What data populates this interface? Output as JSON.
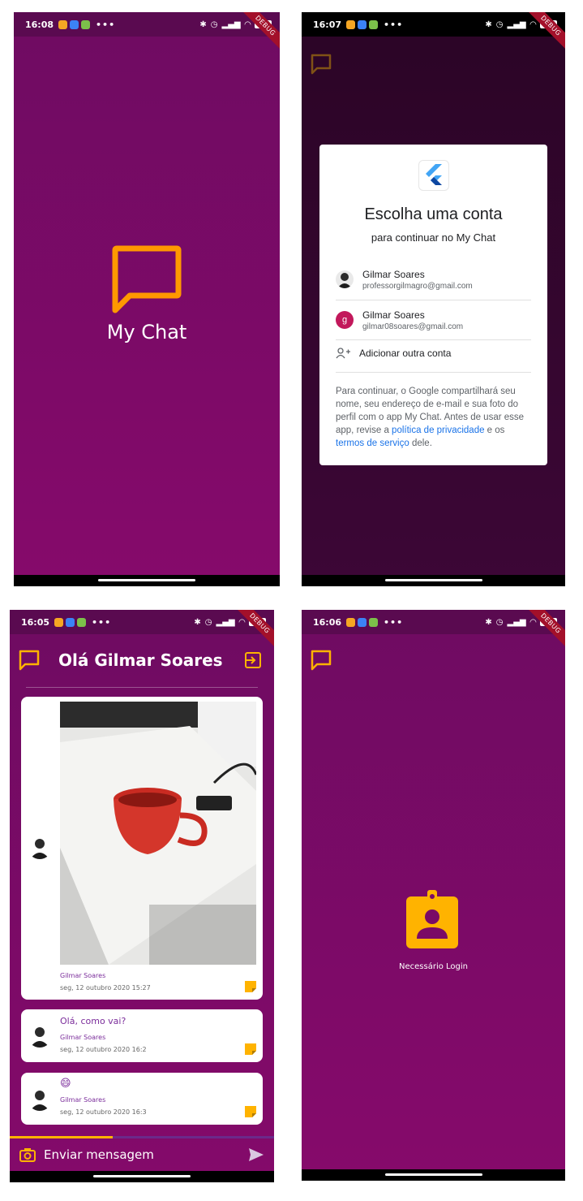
{
  "colors": {
    "primary": "#7a0a66",
    "accent": "#ffb300",
    "splash_logo": "#ff9800",
    "link": "#1a73e8"
  },
  "splash": {
    "status_time": "16:08",
    "battery": "100",
    "debug_label": "DEBUG",
    "app_title": "My Chat"
  },
  "account_picker": {
    "status_time": "16:07",
    "battery": "100",
    "debug_label": "DEBUG",
    "title": "Escolha uma conta",
    "subtitle": "para continuar no My Chat",
    "accounts": [
      {
        "name": "Gilmar Soares",
        "email": "professorgilmagro@gmail.com",
        "avatar": "photo"
      },
      {
        "name": "Gilmar Soares",
        "email": "gilmar08soares@gmail.com",
        "avatar": "g"
      }
    ],
    "add_account": "Adicionar outra conta",
    "note_part1": "Para continuar, o Google compartilhará seu nome, seu endereço de e-mail e sua foto do perfil com o app My Chat. Antes de usar esse app, revise a ",
    "privacy_link": "política de privacidade",
    "note_part2": " e os ",
    "terms_link": "termos de serviço",
    "note_part3": " dele."
  },
  "chat": {
    "status_time": "16:05",
    "battery": "100",
    "debug_label": "DEBUG",
    "header_title": "Olá Gilmar Soares",
    "messages": [
      {
        "type": "image",
        "sender": "Gilmar Soares",
        "time": "seg, 12 outubro 2020 15:27"
      },
      {
        "type": "text",
        "text": "Olá, como vai?",
        "sender": "Gilmar Soares",
        "time": "seg, 12 outubro 2020 16:2"
      },
      {
        "type": "text",
        "text": "😄",
        "sender": "Gilmar Soares",
        "time": "seg, 12 outubro 2020 16:3"
      }
    ],
    "upload_progress": 0.39,
    "composer_placeholder": "Enviar mensagem"
  },
  "login_required": {
    "status_time": "16:06",
    "battery": "100",
    "debug_label": "DEBUG",
    "message": "Necessário Login"
  }
}
